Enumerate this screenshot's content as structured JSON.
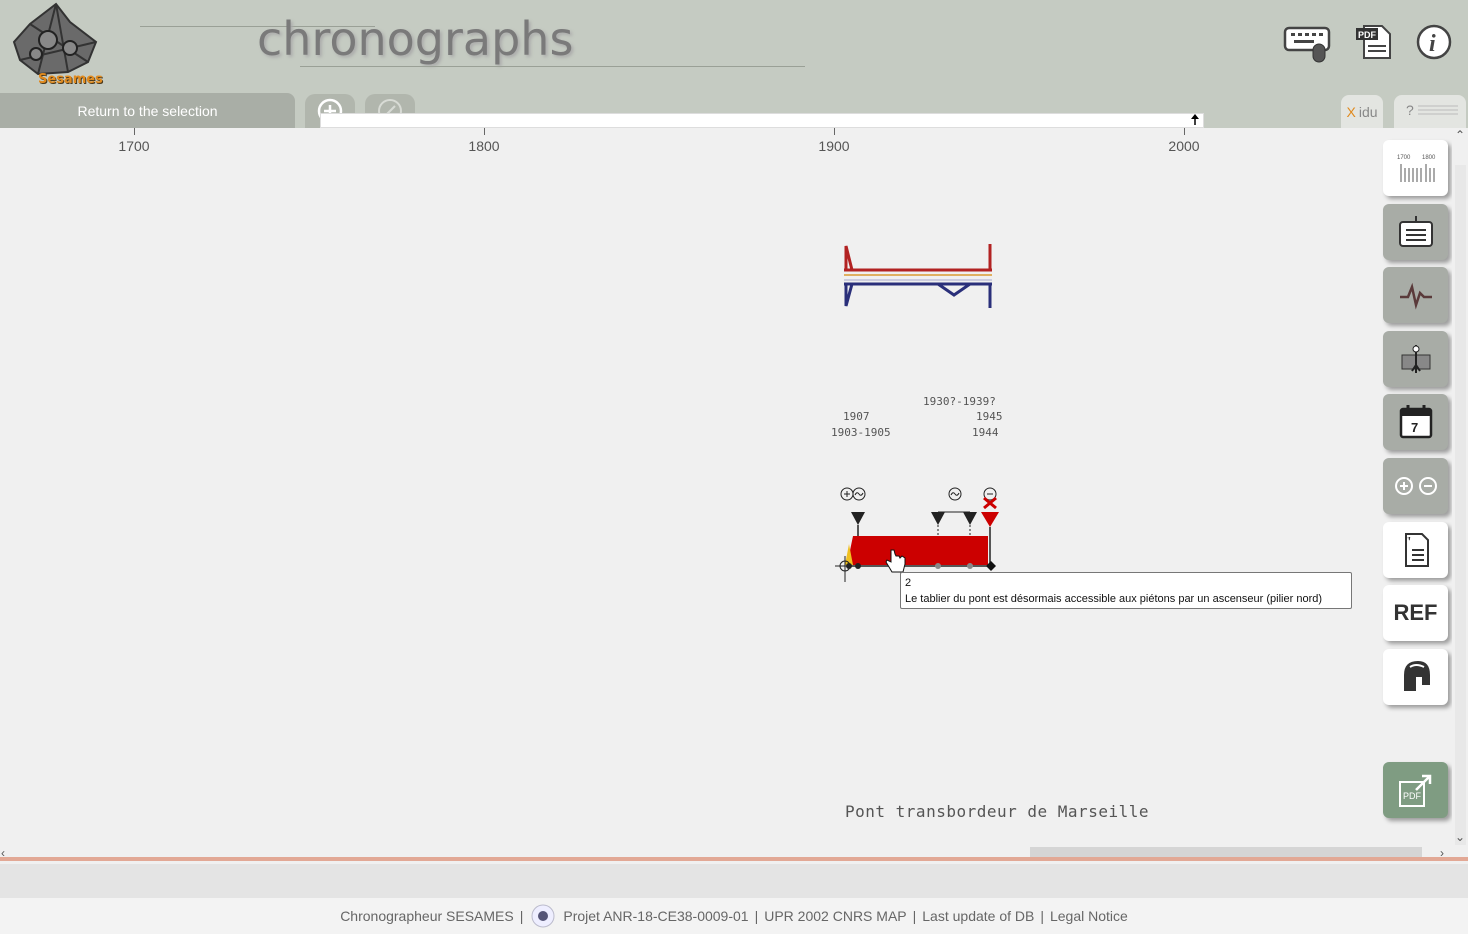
{
  "app": {
    "title": "chronographs",
    "logo_text": "Sesames"
  },
  "nav": {
    "return_label": "Return to the selection",
    "xidu_x": "X",
    "xidu_label": "idu",
    "help_label": "?"
  },
  "timeline": {
    "axis_labels": [
      "1700",
      "1800",
      "1900",
      "2000"
    ]
  },
  "chart": {
    "date_labels": [
      "1930?-1939?",
      "1907",
      "1945",
      "1903-1905",
      "1944"
    ],
    "event_symbols": [
      "⊕~",
      "~",
      "⊖"
    ],
    "tooltip_number": "2",
    "tooltip_text": "Le tablier du pont est désormais accessible aux piétons par un ascenseur (pilier nord)",
    "caption": "Pont transbordeur de Marseille"
  },
  "sidebar": {
    "ref_label": "REF",
    "calendar_day": "7",
    "mini_axis": [
      "1700",
      "1800"
    ]
  },
  "footer": {
    "app_name": "Chronographeur SESAMES",
    "sep": "|",
    "project": "Projet ANR-18-CE38-0009-01",
    "lab": "UPR 2002 CNRS MAP",
    "update": "Last update of DB",
    "legal": "Legal Notice"
  },
  "icons": {
    "keyboard": "keyboard-mouse-icon",
    "pdf": "pdf-icon",
    "info": "info-icon",
    "add": "add-circle-icon",
    "edit": "pencil-icon"
  },
  "colors": {
    "header_bg": "#c5cbc2",
    "accent_orange": "#e08a1e",
    "bar_red": "#cc0000",
    "upper_red": "#b22222",
    "lower_navy": "#2a2f7a",
    "pdf_green": "#7f9c82"
  }
}
